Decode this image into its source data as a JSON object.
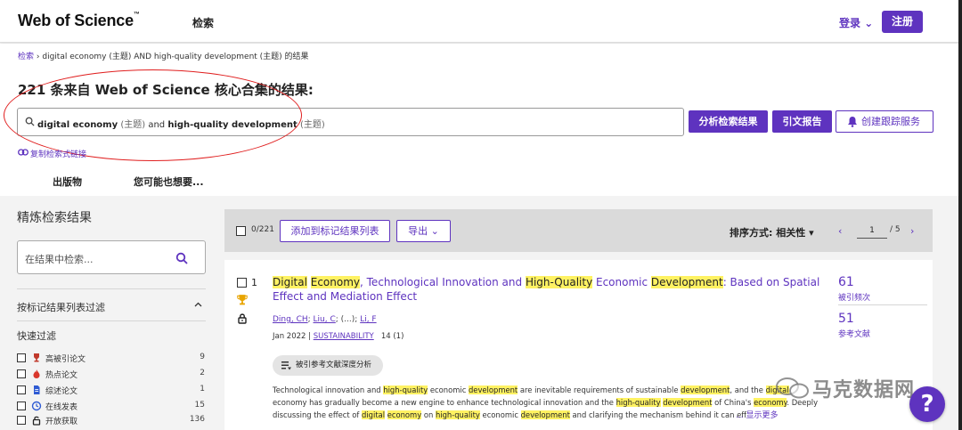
{
  "header": {
    "logo": "Web of Science",
    "logo_tm": "™",
    "nav_search": "检索",
    "login": "登录",
    "register": "注册"
  },
  "breadcrumb": {
    "link": "检索",
    "current": "digital economy (主题) AND high-quality development (主题) 的结果"
  },
  "results": {
    "title": "221 条来自 Web of Science 核心合集的结果:"
  },
  "query": {
    "term1": "digital economy",
    "field1": "(主题)",
    "op": "and",
    "term2": "high-quality development",
    "field2": "(主题)"
  },
  "actions": {
    "analyze": "分析检索结果",
    "citation_report": "引文报告",
    "create_alert": "创建跟踪服务",
    "copy_link": "复制检索式链接"
  },
  "tabs": {
    "publications": "出版物",
    "may_want": "您可能也想要..."
  },
  "sidebar": {
    "title": "精炼检索结果",
    "search_placeholder": "在结果中检索...",
    "filter_marked": "按标记结果列表过滤",
    "quick_filters_title": "快速过滤",
    "quick_filters": [
      {
        "label": "高被引论文",
        "count": "9",
        "icon": "trophy-icon"
      },
      {
        "label": "热点论文",
        "count": "2",
        "icon": "fire-icon"
      },
      {
        "label": "综述论文",
        "count": "1",
        "icon": "document-icon"
      },
      {
        "label": "在线发表",
        "count": "15",
        "icon": "clock-icon"
      },
      {
        "label": "开放获取",
        "count": "136",
        "icon": "lock-open-icon"
      }
    ]
  },
  "toolbar": {
    "selected": "0/221",
    "add_to_marked": "添加到标记结果列表",
    "export": "导出",
    "sort": "排序方式: 相关性",
    "page_current": "1",
    "page_total": "/ 5"
  },
  "result1": {
    "index": "1",
    "title_parts": [
      "Digital",
      " ",
      "Economy",
      ", Technological Innovation and ",
      "High-Quality",
      " Economic ",
      "Development",
      ": Based on Spatial Effect and Mediation Effect"
    ],
    "authors": [
      "Ding, CH",
      "Liu, C",
      "(...)",
      "Li, F"
    ],
    "date": "Jan 2022",
    "journal": "SUSTAINABILITY",
    "issue": "14 (1)",
    "chip": "被引参考文献深度分析",
    "abstract_parts": [
      "Technological innovation and ",
      "high-quality",
      " economic ",
      "development",
      " are inevitable requirements of sustainable ",
      "development",
      ", and the ",
      "digital",
      " economy has gradually become a new engine to enhance technological innovation and the ",
      "high-quality",
      " ",
      "development",
      " of China's ",
      "economy",
      ". Deeply discussing the effect of ",
      "digital",
      " ",
      "economy",
      " on ",
      "high-quality",
      " economic ",
      "development",
      " and clarifying the mechanism behind it can eff"
    ],
    "show_more": "... 显示更多",
    "citations": "61",
    "citations_label": "被引频次",
    "references": "51",
    "references_label": "参考文献"
  },
  "watermark": "马克数据网",
  "help": "?",
  "colors": {
    "accent": "#5e33bf",
    "highlight": "#fff262",
    "annotation": "#e01e1e"
  }
}
